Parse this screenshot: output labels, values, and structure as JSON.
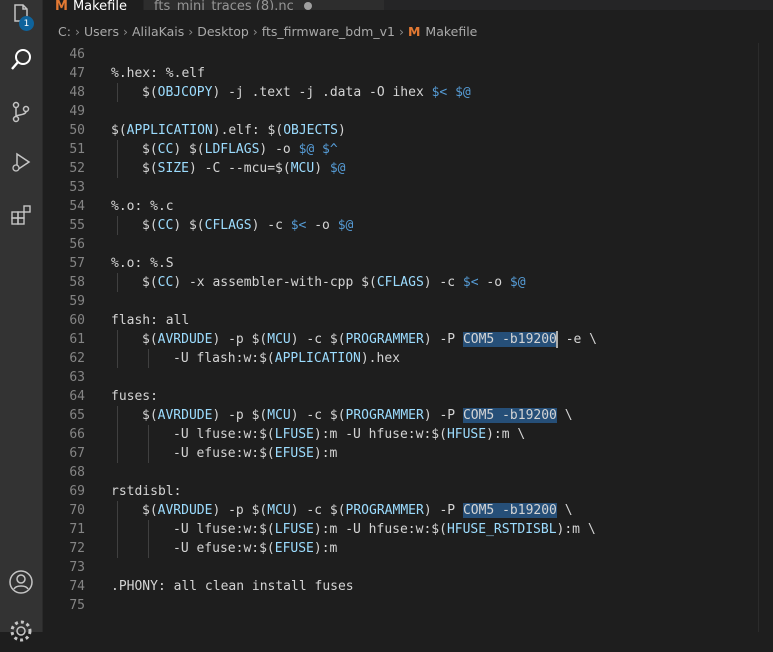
{
  "tabs": [
    {
      "label": "Makefile",
      "active": true,
      "icon": "makefile-icon"
    },
    {
      "label": "fts_mini_traces (8).nc",
      "active": false,
      "modified": true
    }
  ],
  "activity": {
    "badge": "1",
    "items": [
      "explorer-icon",
      "search-icon",
      "source-control-icon",
      "run-debug-icon",
      "extensions-icon",
      "account-icon",
      "settings-gear-icon"
    ]
  },
  "breadcrumb": [
    "C:",
    "Users",
    "AlilaKais",
    "Desktop",
    "fts_firmware_bdm_v1",
    "Makefile"
  ],
  "breadcrumb_file_icon": "M",
  "colors": {
    "accent": "#0e639c",
    "makefile_icon": "#e37933",
    "variable": "#9cdcfe",
    "automatic": "#569cd6",
    "selection": "#264f78"
  },
  "lines": [
    {
      "n": "46",
      "tokens": []
    },
    {
      "n": "47",
      "tokens": [
        [
          "p",
          "%.hex: %.elf"
        ]
      ]
    },
    {
      "n": "48",
      "indent": 1,
      "tokens": [
        [
          "p",
          "$("
        ],
        [
          "v",
          "OBJCOPY"
        ],
        [
          "p",
          ") -j .text -j .data -O ihex "
        ],
        [
          "a",
          "$<"
        ],
        [
          "p",
          " "
        ],
        [
          "a",
          "$@"
        ]
      ]
    },
    {
      "n": "49",
      "tokens": []
    },
    {
      "n": "50",
      "tokens": [
        [
          "p",
          "$("
        ],
        [
          "v",
          "APPLICATION"
        ],
        [
          "p",
          ").elf: $("
        ],
        [
          "v",
          "OBJECTS"
        ],
        [
          "p",
          ")"
        ]
      ]
    },
    {
      "n": "51",
      "indent": 1,
      "tokens": [
        [
          "p",
          "$("
        ],
        [
          "v",
          "CC"
        ],
        [
          "p",
          ") $("
        ],
        [
          "v",
          "LDFLAGS"
        ],
        [
          "p",
          ") -o "
        ],
        [
          "a",
          "$@"
        ],
        [
          "p",
          " "
        ],
        [
          "a",
          "$^"
        ]
      ]
    },
    {
      "n": "52",
      "indent": 1,
      "tokens": [
        [
          "p",
          "$("
        ],
        [
          "v",
          "SIZE"
        ],
        [
          "p",
          ") -C --mcu=$("
        ],
        [
          "v",
          "MCU"
        ],
        [
          "p",
          ") "
        ],
        [
          "a",
          "$@"
        ]
      ]
    },
    {
      "n": "53",
      "tokens": []
    },
    {
      "n": "54",
      "tokens": [
        [
          "p",
          "%.o: %.c"
        ]
      ]
    },
    {
      "n": "55",
      "indent": 1,
      "tokens": [
        [
          "p",
          "$("
        ],
        [
          "v",
          "CC"
        ],
        [
          "p",
          ") $("
        ],
        [
          "v",
          "CFLAGS"
        ],
        [
          "p",
          ") -c "
        ],
        [
          "a",
          "$<"
        ],
        [
          "p",
          " -o "
        ],
        [
          "a",
          "$@"
        ]
      ]
    },
    {
      "n": "56",
      "tokens": []
    },
    {
      "n": "57",
      "tokens": [
        [
          "p",
          "%.o: %.S"
        ]
      ]
    },
    {
      "n": "58",
      "indent": 1,
      "tokens": [
        [
          "p",
          "$("
        ],
        [
          "v",
          "CC"
        ],
        [
          "p",
          ") -x assembler-with-cpp $("
        ],
        [
          "v",
          "CFLAGS"
        ],
        [
          "p",
          ") -c "
        ],
        [
          "a",
          "$<"
        ],
        [
          "p",
          " -o "
        ],
        [
          "a",
          "$@"
        ]
      ]
    },
    {
      "n": "59",
      "tokens": []
    },
    {
      "n": "60",
      "tokens": [
        [
          "p",
          "flash: all"
        ]
      ]
    },
    {
      "n": "61",
      "indent": 1,
      "tokens": [
        [
          "p",
          "$("
        ],
        [
          "v",
          "AVRDUDE"
        ],
        [
          "p",
          ") -p $("
        ],
        [
          "v",
          "MCU"
        ],
        [
          "p",
          ") -c $("
        ],
        [
          "v",
          "PROGRAMMER"
        ],
        [
          "p",
          ") -P "
        ],
        [
          "h",
          "COM5 -b19200"
        ],
        [
          "c",
          ""
        ],
        [
          "p",
          " -e \\"
        ]
      ]
    },
    {
      "n": "62",
      "indent": 2,
      "tokens": [
        [
          "p",
          "-U flash:w:$("
        ],
        [
          "v",
          "APPLICATION"
        ],
        [
          "p",
          ").hex"
        ]
      ]
    },
    {
      "n": "63",
      "tokens": []
    },
    {
      "n": "64",
      "tokens": [
        [
          "p",
          "fuses:"
        ]
      ]
    },
    {
      "n": "65",
      "indent": 1,
      "tokens": [
        [
          "p",
          "$("
        ],
        [
          "v",
          "AVRDUDE"
        ],
        [
          "p",
          ") -p $("
        ],
        [
          "v",
          "MCU"
        ],
        [
          "p",
          ") -c $("
        ],
        [
          "v",
          "PROGRAMMER"
        ],
        [
          "p",
          ") -P "
        ],
        [
          "h",
          "COM5 -b19200"
        ],
        [
          "p",
          " \\"
        ]
      ]
    },
    {
      "n": "66",
      "indent": 2,
      "tokens": [
        [
          "p",
          "-U lfuse:w:$("
        ],
        [
          "v",
          "LFUSE"
        ],
        [
          "p",
          "):m -U hfuse:w:$("
        ],
        [
          "v",
          "HFUSE"
        ],
        [
          "p",
          "):m \\"
        ]
      ]
    },
    {
      "n": "67",
      "indent": 2,
      "tokens": [
        [
          "p",
          "-U efuse:w:$("
        ],
        [
          "v",
          "EFUSE"
        ],
        [
          "p",
          "):m"
        ]
      ]
    },
    {
      "n": "68",
      "tokens": []
    },
    {
      "n": "69",
      "tokens": [
        [
          "p",
          "rstdisbl:"
        ]
      ]
    },
    {
      "n": "70",
      "indent": 1,
      "tokens": [
        [
          "p",
          "$("
        ],
        [
          "v",
          "AVRDUDE"
        ],
        [
          "p",
          ") -p $("
        ],
        [
          "v",
          "MCU"
        ],
        [
          "p",
          ") -c $("
        ],
        [
          "v",
          "PROGRAMMER"
        ],
        [
          "p",
          ") -P "
        ],
        [
          "h",
          "COM5 -b19200"
        ],
        [
          "p",
          " \\"
        ]
      ]
    },
    {
      "n": "71",
      "indent": 2,
      "tokens": [
        [
          "p",
          "-U lfuse:w:$("
        ],
        [
          "v",
          "LFUSE"
        ],
        [
          "p",
          "):m -U hfuse:w:$("
        ],
        [
          "v",
          "HFUSE_RSTDISBL"
        ],
        [
          "p",
          "):m \\"
        ]
      ]
    },
    {
      "n": "72",
      "indent": 2,
      "tokens": [
        [
          "p",
          "-U efuse:w:$("
        ],
        [
          "v",
          "EFUSE"
        ],
        [
          "p",
          "):m"
        ]
      ]
    },
    {
      "n": "73",
      "tokens": []
    },
    {
      "n": "74",
      "tokens": [
        [
          "p",
          ".PHONY: all clean install fuses"
        ]
      ]
    },
    {
      "n": "75",
      "tokens": []
    }
  ]
}
